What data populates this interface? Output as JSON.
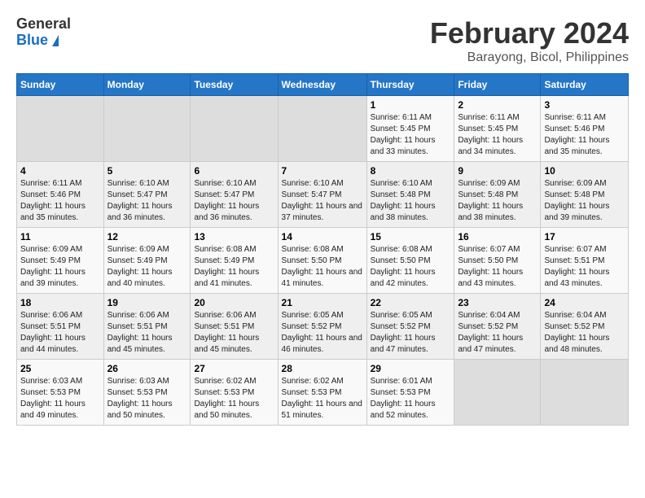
{
  "header": {
    "logo_general": "General",
    "logo_blue": "Blue",
    "title": "February 2024",
    "subtitle": "Barayong, Bicol, Philippines"
  },
  "weekdays": [
    "Sunday",
    "Monday",
    "Tuesday",
    "Wednesday",
    "Thursday",
    "Friday",
    "Saturday"
  ],
  "weeks": [
    [
      {
        "day": "",
        "info": ""
      },
      {
        "day": "",
        "info": ""
      },
      {
        "day": "",
        "info": ""
      },
      {
        "day": "",
        "info": ""
      },
      {
        "day": "1",
        "info": "Sunrise: 6:11 AM\nSunset: 5:45 PM\nDaylight: 11 hours and 33 minutes."
      },
      {
        "day": "2",
        "info": "Sunrise: 6:11 AM\nSunset: 5:45 PM\nDaylight: 11 hours and 34 minutes."
      },
      {
        "day": "3",
        "info": "Sunrise: 6:11 AM\nSunset: 5:46 PM\nDaylight: 11 hours and 35 minutes."
      }
    ],
    [
      {
        "day": "4",
        "info": "Sunrise: 6:11 AM\nSunset: 5:46 PM\nDaylight: 11 hours and 35 minutes."
      },
      {
        "day": "5",
        "info": "Sunrise: 6:10 AM\nSunset: 5:47 PM\nDaylight: 11 hours and 36 minutes."
      },
      {
        "day": "6",
        "info": "Sunrise: 6:10 AM\nSunset: 5:47 PM\nDaylight: 11 hours and 36 minutes."
      },
      {
        "day": "7",
        "info": "Sunrise: 6:10 AM\nSunset: 5:47 PM\nDaylight: 11 hours and 37 minutes."
      },
      {
        "day": "8",
        "info": "Sunrise: 6:10 AM\nSunset: 5:48 PM\nDaylight: 11 hours and 38 minutes."
      },
      {
        "day": "9",
        "info": "Sunrise: 6:09 AM\nSunset: 5:48 PM\nDaylight: 11 hours and 38 minutes."
      },
      {
        "day": "10",
        "info": "Sunrise: 6:09 AM\nSunset: 5:48 PM\nDaylight: 11 hours and 39 minutes."
      }
    ],
    [
      {
        "day": "11",
        "info": "Sunrise: 6:09 AM\nSunset: 5:49 PM\nDaylight: 11 hours and 39 minutes."
      },
      {
        "day": "12",
        "info": "Sunrise: 6:09 AM\nSunset: 5:49 PM\nDaylight: 11 hours and 40 minutes."
      },
      {
        "day": "13",
        "info": "Sunrise: 6:08 AM\nSunset: 5:49 PM\nDaylight: 11 hours and 41 minutes."
      },
      {
        "day": "14",
        "info": "Sunrise: 6:08 AM\nSunset: 5:50 PM\nDaylight: 11 hours and 41 minutes."
      },
      {
        "day": "15",
        "info": "Sunrise: 6:08 AM\nSunset: 5:50 PM\nDaylight: 11 hours and 42 minutes."
      },
      {
        "day": "16",
        "info": "Sunrise: 6:07 AM\nSunset: 5:50 PM\nDaylight: 11 hours and 43 minutes."
      },
      {
        "day": "17",
        "info": "Sunrise: 6:07 AM\nSunset: 5:51 PM\nDaylight: 11 hours and 43 minutes."
      }
    ],
    [
      {
        "day": "18",
        "info": "Sunrise: 6:06 AM\nSunset: 5:51 PM\nDaylight: 11 hours and 44 minutes."
      },
      {
        "day": "19",
        "info": "Sunrise: 6:06 AM\nSunset: 5:51 PM\nDaylight: 11 hours and 45 minutes."
      },
      {
        "day": "20",
        "info": "Sunrise: 6:06 AM\nSunset: 5:51 PM\nDaylight: 11 hours and 45 minutes."
      },
      {
        "day": "21",
        "info": "Sunrise: 6:05 AM\nSunset: 5:52 PM\nDaylight: 11 hours and 46 minutes."
      },
      {
        "day": "22",
        "info": "Sunrise: 6:05 AM\nSunset: 5:52 PM\nDaylight: 11 hours and 47 minutes."
      },
      {
        "day": "23",
        "info": "Sunrise: 6:04 AM\nSunset: 5:52 PM\nDaylight: 11 hours and 47 minutes."
      },
      {
        "day": "24",
        "info": "Sunrise: 6:04 AM\nSunset: 5:52 PM\nDaylight: 11 hours and 48 minutes."
      }
    ],
    [
      {
        "day": "25",
        "info": "Sunrise: 6:03 AM\nSunset: 5:53 PM\nDaylight: 11 hours and 49 minutes."
      },
      {
        "day": "26",
        "info": "Sunrise: 6:03 AM\nSunset: 5:53 PM\nDaylight: 11 hours and 50 minutes."
      },
      {
        "day": "27",
        "info": "Sunrise: 6:02 AM\nSunset: 5:53 PM\nDaylight: 11 hours and 50 minutes."
      },
      {
        "day": "28",
        "info": "Sunrise: 6:02 AM\nSunset: 5:53 PM\nDaylight: 11 hours and 51 minutes."
      },
      {
        "day": "29",
        "info": "Sunrise: 6:01 AM\nSunset: 5:53 PM\nDaylight: 11 hours and 52 minutes."
      },
      {
        "day": "",
        "info": ""
      },
      {
        "day": "",
        "info": ""
      }
    ]
  ]
}
